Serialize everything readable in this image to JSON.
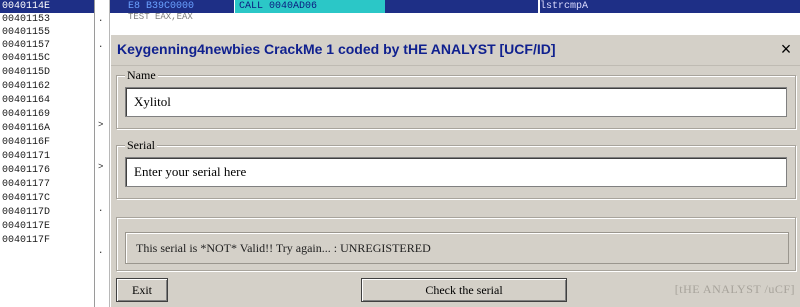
{
  "debugger": {
    "addresses": [
      "0040114E",
      "00401153",
      "00401155",
      "00401157",
      "0040115C",
      "0040115D",
      "00401162",
      "00401164",
      "00401169",
      "0040116A",
      "0040116F",
      "00401171",
      "00401176",
      "00401177",
      "0040117C",
      "0040117D",
      "0040117E",
      "0040117F"
    ],
    "top_row": {
      "hex": "E8 B39C0000",
      "instruction": "CALL 0040AD06",
      "comment": "lstrcmpA"
    },
    "row2": "TEST EAX,EAX"
  },
  "dialog": {
    "title": "Keygenning4newbies CrackMe 1 coded by tHE ANALYST [UCF/ID]",
    "close_glyph": "×",
    "name": {
      "label": "Name",
      "value": "Xylitol"
    },
    "serial": {
      "label": "Serial",
      "value": "Enter your serial here"
    },
    "status": "This serial is *NOT* Valid!! Try again... : UNREGISTERED",
    "buttons": {
      "exit": "Exit",
      "check": "Check the serial"
    },
    "signature": "[tHE ANALYST /uCF]"
  },
  "colors": {
    "selection": "#1e2f86",
    "call_highlight": "#2bc7c7",
    "title_text": "#10218f",
    "dialog_bg": "#d4d0c8"
  }
}
